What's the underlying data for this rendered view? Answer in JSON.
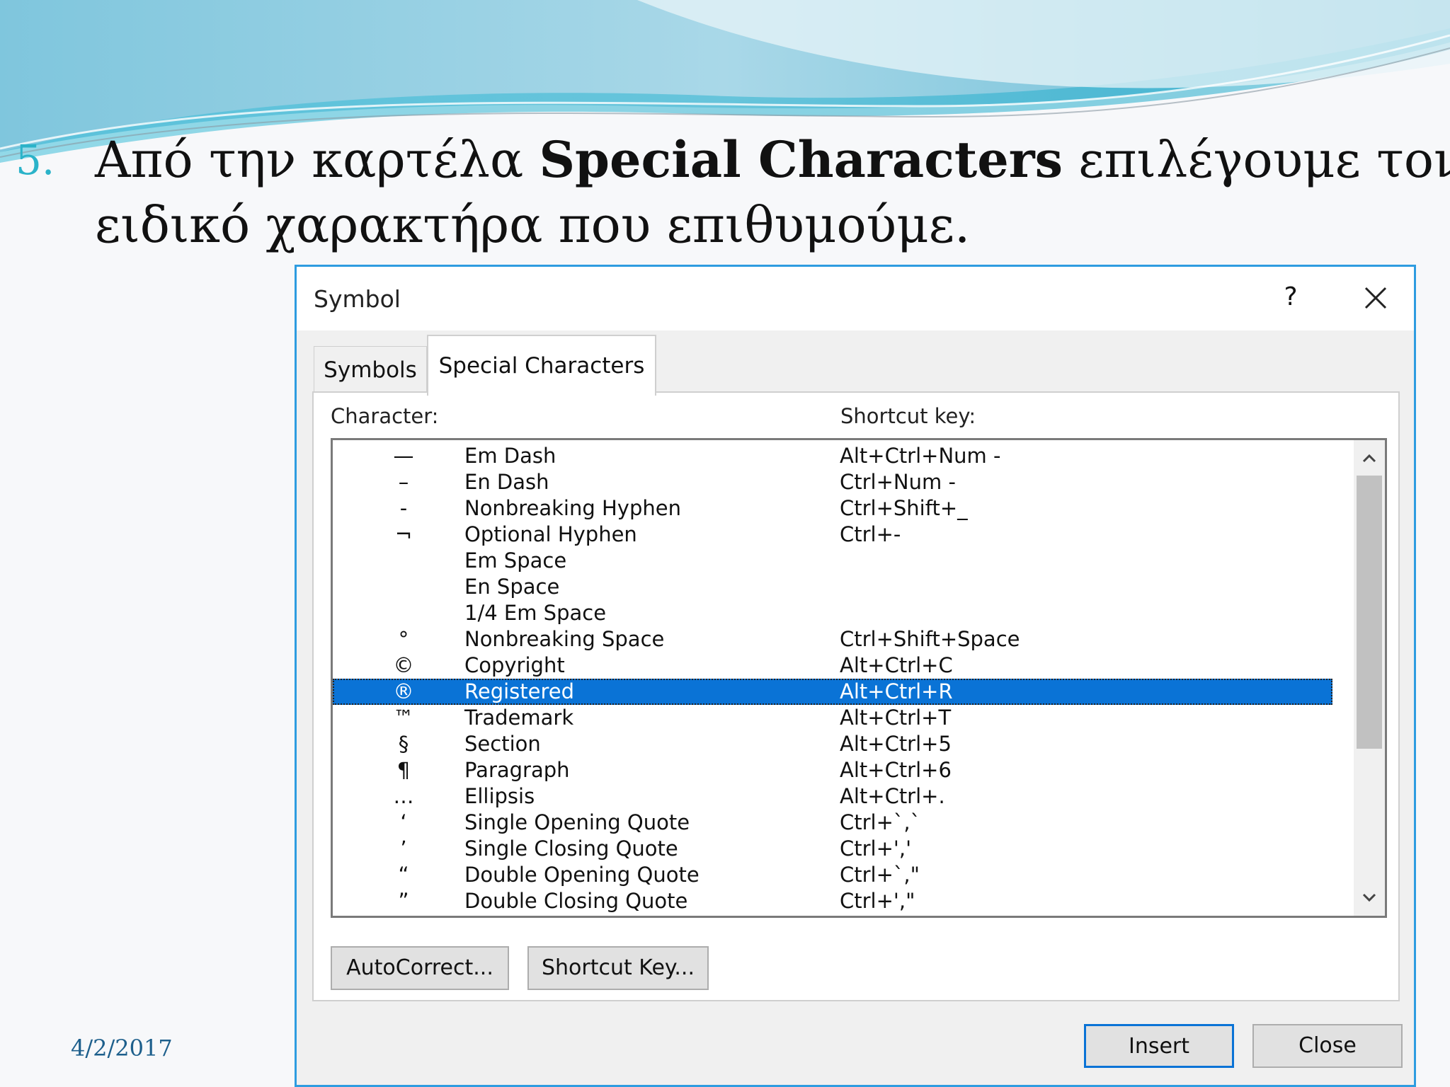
{
  "slide": {
    "step_number": "5.",
    "line1_before": "Από την καρτέλα ",
    "line1_bold": "Special Characters",
    "line1_after": " επιλέγουμε τον",
    "line2": "ειδικό χαρακτήρα που επιθυμούμε.",
    "date": "4/2/2017"
  },
  "dialog": {
    "title": "Symbol",
    "help_label": "?",
    "tabs": [
      {
        "label": "Symbols",
        "active": false
      },
      {
        "label": "Special Characters",
        "active": true
      }
    ],
    "columns": {
      "character": "Character:",
      "shortcut": "Shortcut key:"
    },
    "rows": [
      {
        "symbol": "—",
        "name": "Em Dash",
        "shortcut": "Alt+Ctrl+Num -"
      },
      {
        "symbol": "–",
        "name": "En Dash",
        "shortcut": "Ctrl+Num -"
      },
      {
        "symbol": "-",
        "name": "Nonbreaking Hyphen",
        "shortcut": "Ctrl+Shift+_"
      },
      {
        "symbol": "¬",
        "name": "Optional Hyphen",
        "shortcut": "Ctrl+-"
      },
      {
        "symbol": "",
        "name": "Em Space",
        "shortcut": ""
      },
      {
        "symbol": "",
        "name": "En Space",
        "shortcut": ""
      },
      {
        "symbol": "",
        "name": "1/4 Em Space",
        "shortcut": ""
      },
      {
        "symbol": "°",
        "name": "Nonbreaking Space",
        "shortcut": "Ctrl+Shift+Space"
      },
      {
        "symbol": "©",
        "name": "Copyright",
        "shortcut": "Alt+Ctrl+C"
      },
      {
        "symbol": "®",
        "name": "Registered",
        "shortcut": "Alt+Ctrl+R"
      },
      {
        "symbol": "™",
        "name": "Trademark",
        "shortcut": "Alt+Ctrl+T"
      },
      {
        "symbol": "§",
        "name": "Section",
        "shortcut": "Alt+Ctrl+5"
      },
      {
        "symbol": "¶",
        "name": "Paragraph",
        "shortcut": "Alt+Ctrl+6"
      },
      {
        "symbol": "…",
        "name": "Ellipsis",
        "shortcut": "Alt+Ctrl+."
      },
      {
        "symbol": "‘",
        "name": "Single Opening Quote",
        "shortcut": "Ctrl+`,`"
      },
      {
        "symbol": "’",
        "name": "Single Closing Quote",
        "shortcut": "Ctrl+','"
      },
      {
        "symbol": "“",
        "name": "Double Opening Quote",
        "shortcut": "Ctrl+`,\""
      },
      {
        "symbol": "”",
        "name": "Double Closing Quote",
        "shortcut": "Ctrl+',\""
      }
    ],
    "selected_index": 9,
    "buttons": {
      "autocorrect": "AutoCorrect...",
      "shortcut_key": "Shortcut Key...",
      "insert": "Insert",
      "close": "Close"
    }
  },
  "colors": {
    "accent": "#0a73d6",
    "step_number": "#2bb3c9",
    "date": "#1d5f8c",
    "dialog_border": "#2e9ce0"
  }
}
